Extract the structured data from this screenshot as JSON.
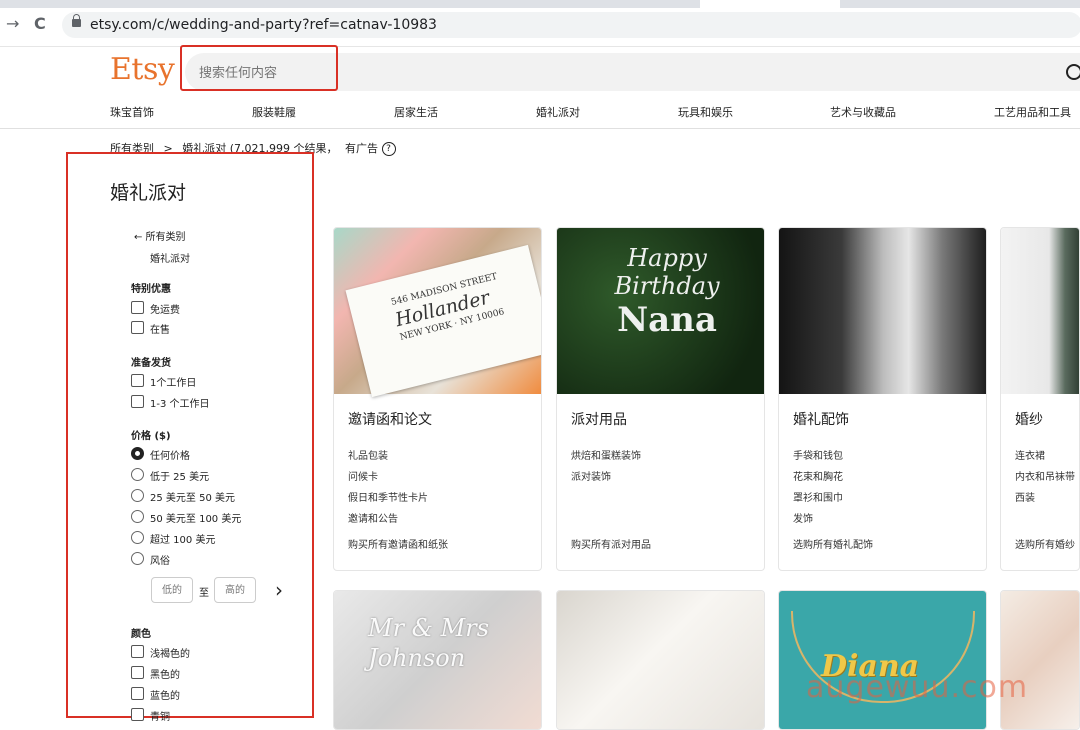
{
  "browser": {
    "url": "etsy.com/c/wedding-and-party?ref=catnav-10983",
    "back_icon": "→",
    "reload_icon": "C"
  },
  "header": {
    "logo": "Etsy",
    "search_placeholder": "搜索任何内容"
  },
  "cat_nav": [
    "珠宝首饰",
    "服装鞋履",
    "居家生活",
    "婚礼派对",
    "玩具和娱乐",
    "艺术与收藏品",
    "工艺用品和工具"
  ],
  "breadcrumb": {
    "all": "所有类别",
    "sep": ">",
    "current": "婚礼派对 (7,021,999 个结果，",
    "ad": "有广告",
    "help": "?"
  },
  "sidebar": {
    "title": "婚礼派对",
    "back_link": "← 所有类别",
    "current_link": "婚礼派对",
    "special": {
      "heading": "特别优惠",
      "options": [
        "免运费",
        "在售"
      ]
    },
    "ready": {
      "heading": "准备发货",
      "options": [
        "1个工作日",
        "1-3 个工作日"
      ]
    },
    "price": {
      "heading": "价格 ($)",
      "options": [
        "任何价格",
        "低于 25 美元",
        "25 美元至 50 美元",
        "50 美元至 100 美元",
        "超过 100 美元",
        "风俗"
      ],
      "low": "低的",
      "to": "至",
      "high": "高的",
      "go": "›"
    },
    "color": {
      "heading": "颜色",
      "options": [
        "浅褐色的",
        "黑色的",
        "蓝色的",
        "青铜"
      ]
    }
  },
  "cards": [
    {
      "title": "邀请函和论文",
      "subs": [
        "礼品包装",
        "问候卡",
        "假日和季节性卡片",
        "邀请和公告"
      ],
      "shop_all": "购买所有邀请函和纸张",
      "image_text": {
        "street": "546 MADISON STREET",
        "name": "Hollander",
        "city": "NEW YORK · NY 10006"
      }
    },
    {
      "title": "派对用品",
      "subs": [
        "烘焙和蛋糕装饰",
        "派对装饰"
      ],
      "shop_all": "购买所有派对用品",
      "image_text": {
        "l1": "Happy",
        "l2": "Birthday",
        "l3": "Nana"
      }
    },
    {
      "title": "婚礼配饰",
      "subs": [
        "手袋和钱包",
        "花束和胸花",
        "罩衫和围巾",
        "发饰"
      ],
      "shop_all": "选购所有婚礼配饰"
    },
    {
      "title": "婚纱",
      "subs": [
        "连衣裙",
        "内衣和吊袜带",
        "西装"
      ],
      "shop_all": "选购所有婚纱"
    }
  ],
  "row2": {
    "box_text": "Mr & Mrs Johnson",
    "necklace_text": "Diana"
  },
  "watermark": "augewuu.com"
}
